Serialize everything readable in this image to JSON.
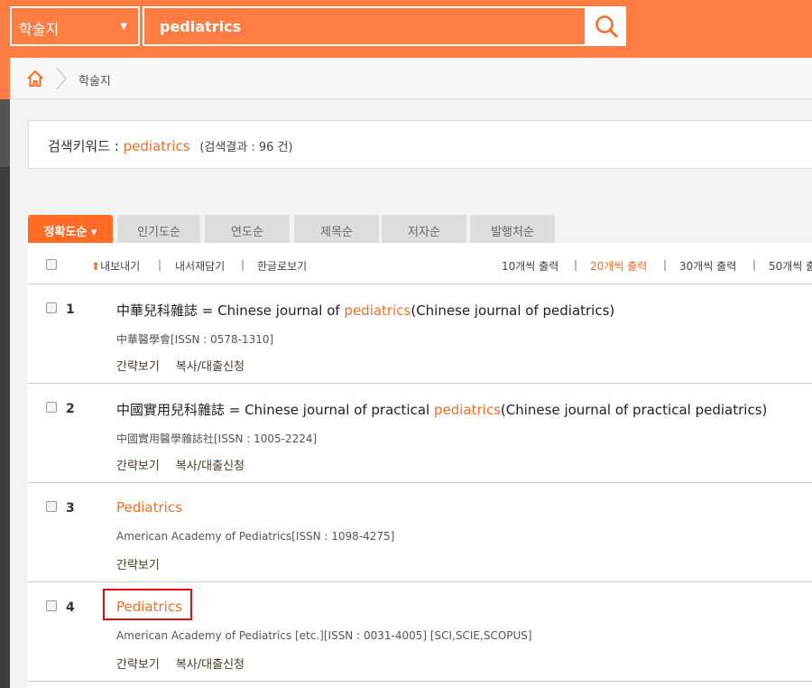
{
  "header": {
    "category_select": "학술지",
    "search_value": "pediatrics"
  },
  "breadcrumb": {
    "current": "학술지"
  },
  "keyword_box": {
    "label": "검색키워드 :",
    "keyword": "pediatrics",
    "result_count": "(검색결과 : 96 건)"
  },
  "sort_tabs": [
    {
      "label": "정확도순 ▾",
      "active": true
    },
    {
      "label": "인기도순",
      "active": false
    },
    {
      "label": "연도순",
      "active": false
    },
    {
      "label": "제목순",
      "active": false
    },
    {
      "label": "저자순",
      "active": false
    },
    {
      "label": "발행처순",
      "active": false
    }
  ],
  "toolbar": {
    "export": "내보내기",
    "save": "내서재담기",
    "korean_view": "한글로보기",
    "per_page": [
      "10개씩 출력",
      "20개씩 출력",
      "30개씩 출력",
      "50개씩 출"
    ]
  },
  "results": [
    {
      "num": "1",
      "title_pre": "中華兒科雜誌 = Chinese journal of ",
      "title_kw": "pediatrics",
      "title_post": "(Chinese journal of pediatrics)",
      "publisher": "中華醫學會[ISSN : 0578-1310]",
      "links": [
        "간략보기",
        "복사/대출신청"
      ]
    },
    {
      "num": "2",
      "title_pre": "中國實用兒科雜誌 = Chinese journal of practical ",
      "title_kw": "pediatrics",
      "title_post": "(Chinese journal of practical pediatrics)",
      "publisher": "中國實用醫學雜誌社[ISSN : 1005-2224]",
      "links": [
        "간략보기",
        "복사/대출신청"
      ]
    },
    {
      "num": "3",
      "title_pre": "",
      "title_kw": "Pediatrics",
      "title_post": "",
      "publisher": "American Academy of Pediatrics[ISSN : 1098-4275]",
      "links": [
        "간략보기"
      ]
    },
    {
      "num": "4",
      "title_pre": "",
      "title_kw": "Pediatrics",
      "title_post": "",
      "publisher": "American Academy of Pediatrics [etc.][ISSN : 0031-4005] [SCI,SCIE,SCOPUS]",
      "links": [
        "간략보기",
        "복사/대출신청"
      ]
    }
  ],
  "colors": {
    "brand": "#ff7c43",
    "accent": "#ff6a24",
    "highlight_box": "#e01010"
  }
}
